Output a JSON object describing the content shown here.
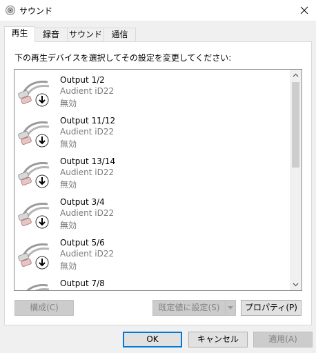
{
  "window": {
    "title": "サウンド",
    "icon": "speaker-icon",
    "close_icon": "close-icon"
  },
  "tabs": [
    {
      "label": "再生",
      "active": true
    },
    {
      "label": "録音",
      "active": false
    },
    {
      "label": "サウンド",
      "active": false
    },
    {
      "label": "通信",
      "active": false
    }
  ],
  "instruction": "下の再生デバイスを選択してその設定を変更してください:",
  "devices": [
    {
      "name": "Output 1/2",
      "driver": "Audient iD22",
      "status": "無効",
      "icon": "rca-cable-disabled-icon"
    },
    {
      "name": "Output 11/12",
      "driver": "Audient iD22",
      "status": "無効",
      "icon": "rca-cable-disabled-icon"
    },
    {
      "name": "Output 13/14",
      "driver": "Audient iD22",
      "status": "無効",
      "icon": "rca-cable-disabled-icon"
    },
    {
      "name": "Output 3/4",
      "driver": "Audient iD22",
      "status": "無効",
      "icon": "rca-cable-disabled-icon"
    },
    {
      "name": "Output 5/6",
      "driver": "Audient iD22",
      "status": "無効",
      "icon": "rca-cable-disabled-icon"
    },
    {
      "name": "Output 7/8",
      "driver": "",
      "status": "",
      "icon": "rca-cable-disabled-icon"
    }
  ],
  "panel_buttons": {
    "configure": "構成(C)",
    "set_default": "既定値に設定(S)",
    "properties": "プロパティ(P)"
  },
  "dialog_buttons": {
    "ok": "OK",
    "cancel": "キャンセル",
    "apply": "適用(A)"
  },
  "colors": {
    "accent": "#0078d7",
    "disabled_text": "#838383",
    "secondary_text": "#7a7a7a"
  }
}
